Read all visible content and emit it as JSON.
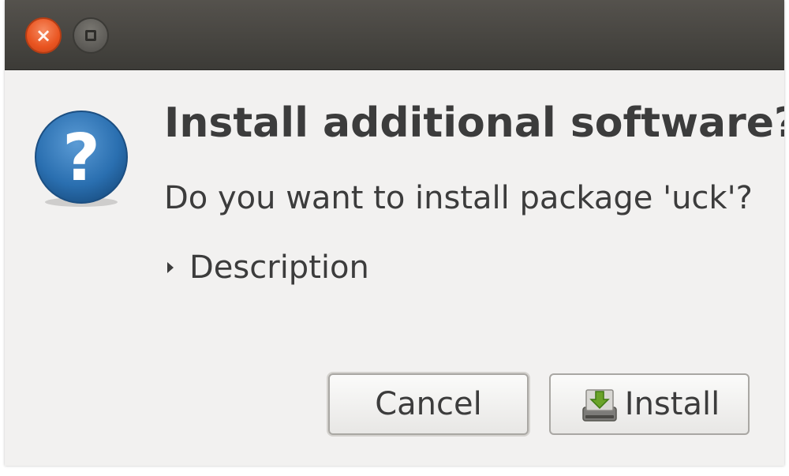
{
  "window": {
    "controls": {
      "close_icon": "close-icon",
      "maximize_icon": "maximize-icon"
    }
  },
  "dialog": {
    "icon": "question-icon",
    "title": "Install additional software?",
    "message": "Do you want to install package 'uck'?",
    "expander": {
      "label": "Description",
      "expanded": false
    },
    "buttons": {
      "cancel_label": "Cancel",
      "install_label": "Install",
      "install_icon": "download-drive-icon"
    }
  },
  "colors": {
    "accent": "#e95420",
    "icon_blue": "#2a6fb0"
  }
}
